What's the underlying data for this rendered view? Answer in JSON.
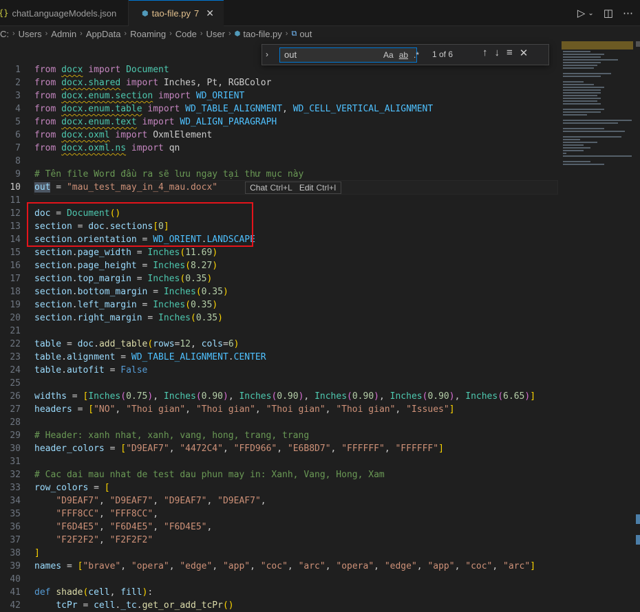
{
  "tabs": [
    {
      "icon": "{}",
      "label": "chatLanguageModels.json",
      "active": false
    },
    {
      "icon": "⬢",
      "label": "tao-file.py",
      "badge": "7",
      "active": true
    }
  ],
  "breadcrumb": [
    "C:",
    "Users",
    "Admin",
    "AppData",
    "Roaming",
    "Code",
    "User",
    "tao-file.py",
    "out"
  ],
  "find": {
    "query": "out",
    "opt_case": "Aa",
    "opt_word": "ab",
    "opt_regex": ".*",
    "count": "1 of 6"
  },
  "inline_hint": {
    "chat": "Chat",
    "chat_key": "Ctrl+L",
    "edit": "Edit",
    "edit_key": "Ctrl+I"
  },
  "line_numbers": [
    "1",
    "2",
    "3",
    "4",
    "5",
    "6",
    "7",
    "8",
    "9",
    "10",
    "11",
    "12",
    "13",
    "14",
    "15",
    "16",
    "17",
    "18",
    "19",
    "20",
    "21",
    "22",
    "23",
    "24",
    "25",
    "26",
    "27",
    "28",
    "29",
    "30",
    "31",
    "32",
    "33",
    "34",
    "35",
    "36",
    "37",
    "38",
    "39",
    "40",
    "41",
    "42"
  ],
  "current_line": 10,
  "code": [
    [
      [
        "k",
        "from "
      ],
      [
        "m",
        "docx"
      ],
      [
        "k",
        " import "
      ],
      [
        "m",
        "Document"
      ]
    ],
    [
      [
        "k",
        "from "
      ],
      [
        "m",
        "docx.shared"
      ],
      [
        "k",
        " import "
      ],
      [
        "p",
        "Inches, Pt, RGBColor"
      ]
    ],
    [
      [
        "k",
        "from "
      ],
      [
        "m",
        "docx.enum.section"
      ],
      [
        "k",
        " import "
      ],
      [
        "c",
        "WD_ORIENT"
      ]
    ],
    [
      [
        "k",
        "from "
      ],
      [
        "m",
        "docx.enum.table"
      ],
      [
        "k",
        " import "
      ],
      [
        "c",
        "WD_TABLE_ALIGNMENT"
      ],
      [
        "p",
        ", "
      ],
      [
        "c",
        "WD_CELL_VERTICAL_ALIGNMENT"
      ]
    ],
    [
      [
        "k",
        "from "
      ],
      [
        "m",
        "docx.enum.text"
      ],
      [
        "k",
        " import "
      ],
      [
        "c",
        "WD_ALIGN_PARAGRAPH"
      ]
    ],
    [
      [
        "k",
        "from "
      ],
      [
        "m",
        "docx.oxml"
      ],
      [
        "k",
        " import "
      ],
      [
        "p",
        "OxmlElement"
      ]
    ],
    [
      [
        "k",
        "from "
      ],
      [
        "m",
        "docx.oxml.ns"
      ],
      [
        "k",
        " import "
      ],
      [
        "p",
        "qn"
      ]
    ],
    [],
    [
      [
        "cm",
        "# Tên file Word đầu ra sẽ lưu ngay tại thư mục này"
      ]
    ],
    [
      [
        "vm",
        "out"
      ],
      [
        "p",
        " = "
      ],
      [
        "s",
        "\"mau_test_may_in_4_mau.docx\""
      ]
    ],
    [],
    [
      [
        "v",
        "doc"
      ],
      [
        "p",
        " = "
      ],
      [
        "m",
        "Document"
      ],
      [
        "br1",
        "()"
      ]
    ],
    [
      [
        "v",
        "section"
      ],
      [
        "p",
        " = "
      ],
      [
        "v",
        "doc"
      ],
      [
        "p",
        "."
      ],
      [
        "v",
        "sections"
      ],
      [
        "br1",
        "["
      ],
      [
        "n",
        "0"
      ],
      [
        "br1",
        "]"
      ]
    ],
    [
      [
        "v",
        "section"
      ],
      [
        "p",
        "."
      ],
      [
        "v",
        "orientation"
      ],
      [
        "p",
        " = "
      ],
      [
        "c",
        "WD_ORIENT"
      ],
      [
        "p",
        "."
      ],
      [
        "c",
        "LANDSCAPE"
      ]
    ],
    [
      [
        "v",
        "section"
      ],
      [
        "p",
        "."
      ],
      [
        "v",
        "page_width"
      ],
      [
        "p",
        " = "
      ],
      [
        "m",
        "Inches"
      ],
      [
        "br1",
        "("
      ],
      [
        "n",
        "11.69"
      ],
      [
        "br1",
        ")"
      ]
    ],
    [
      [
        "v",
        "section"
      ],
      [
        "p",
        "."
      ],
      [
        "v",
        "page_height"
      ],
      [
        "p",
        " = "
      ],
      [
        "m",
        "Inches"
      ],
      [
        "br1",
        "("
      ],
      [
        "n",
        "8.27"
      ],
      [
        "br1",
        ")"
      ]
    ],
    [
      [
        "v",
        "section"
      ],
      [
        "p",
        "."
      ],
      [
        "v",
        "top_margin"
      ],
      [
        "p",
        " = "
      ],
      [
        "m",
        "Inches"
      ],
      [
        "br1",
        "("
      ],
      [
        "n",
        "0.35"
      ],
      [
        "br1",
        ")"
      ]
    ],
    [
      [
        "v",
        "section"
      ],
      [
        "p",
        "."
      ],
      [
        "v",
        "bottom_margin"
      ],
      [
        "p",
        " = "
      ],
      [
        "m",
        "Inches"
      ],
      [
        "br1",
        "("
      ],
      [
        "n",
        "0.35"
      ],
      [
        "br1",
        ")"
      ]
    ],
    [
      [
        "v",
        "section"
      ],
      [
        "p",
        "."
      ],
      [
        "v",
        "left_margin"
      ],
      [
        "p",
        " = "
      ],
      [
        "m",
        "Inches"
      ],
      [
        "br1",
        "("
      ],
      [
        "n",
        "0.35"
      ],
      [
        "br1",
        ")"
      ]
    ],
    [
      [
        "v",
        "section"
      ],
      [
        "p",
        "."
      ],
      [
        "v",
        "right_margin"
      ],
      [
        "p",
        " = "
      ],
      [
        "m",
        "Inches"
      ],
      [
        "br1",
        "("
      ],
      [
        "n",
        "0.35"
      ],
      [
        "br1",
        ")"
      ]
    ],
    [],
    [
      [
        "v",
        "table"
      ],
      [
        "p",
        " = "
      ],
      [
        "v",
        "doc"
      ],
      [
        "p",
        "."
      ],
      [
        "f",
        "add_table"
      ],
      [
        "br1",
        "("
      ],
      [
        "v",
        "rows"
      ],
      [
        "p",
        "="
      ],
      [
        "n",
        "12"
      ],
      [
        "p",
        ", "
      ],
      [
        "v",
        "cols"
      ],
      [
        "p",
        "="
      ],
      [
        "n",
        "6"
      ],
      [
        "br1",
        ")"
      ]
    ],
    [
      [
        "v",
        "table"
      ],
      [
        "p",
        "."
      ],
      [
        "v",
        "alignment"
      ],
      [
        "p",
        " = "
      ],
      [
        "c",
        "WD_TABLE_ALIGNMENT"
      ],
      [
        "p",
        "."
      ],
      [
        "c",
        "CENTER"
      ]
    ],
    [
      [
        "v",
        "table"
      ],
      [
        "p",
        "."
      ],
      [
        "v",
        "autofit"
      ],
      [
        "p",
        " = "
      ],
      [
        "kw",
        "False"
      ]
    ],
    [],
    [
      [
        "v",
        "widths"
      ],
      [
        "p",
        " = "
      ],
      [
        "br1",
        "["
      ],
      [
        "m",
        "Inches"
      ],
      [
        "br2",
        "("
      ],
      [
        "n",
        "0.75"
      ],
      [
        "br2",
        ")"
      ],
      [
        "p",
        ", "
      ],
      [
        "m",
        "Inches"
      ],
      [
        "br2",
        "("
      ],
      [
        "n",
        "0.90"
      ],
      [
        "br2",
        ")"
      ],
      [
        "p",
        ", "
      ],
      [
        "m",
        "Inches"
      ],
      [
        "br2",
        "("
      ],
      [
        "n",
        "0.90"
      ],
      [
        "br2",
        ")"
      ],
      [
        "p",
        ", "
      ],
      [
        "m",
        "Inches"
      ],
      [
        "br2",
        "("
      ],
      [
        "n",
        "0.90"
      ],
      [
        "br2",
        ")"
      ],
      [
        "p",
        ", "
      ],
      [
        "m",
        "Inches"
      ],
      [
        "br2",
        "("
      ],
      [
        "n",
        "0.90"
      ],
      [
        "br2",
        ")"
      ],
      [
        "p",
        ", "
      ],
      [
        "m",
        "Inches"
      ],
      [
        "br2",
        "("
      ],
      [
        "n",
        "6.65"
      ],
      [
        "br2",
        ")"
      ],
      [
        "br1",
        "]"
      ]
    ],
    [
      [
        "v",
        "headers"
      ],
      [
        "p",
        " = "
      ],
      [
        "br1",
        "["
      ],
      [
        "s",
        "\"NO\""
      ],
      [
        "p",
        ", "
      ],
      [
        "s",
        "\"Thoi gian\""
      ],
      [
        "p",
        ", "
      ],
      [
        "s",
        "\"Thoi gian\""
      ],
      [
        "p",
        ", "
      ],
      [
        "s",
        "\"Thoi gian\""
      ],
      [
        "p",
        ", "
      ],
      [
        "s",
        "\"Thoi gian\""
      ],
      [
        "p",
        ", "
      ],
      [
        "s",
        "\"Issues\""
      ],
      [
        "br1",
        "]"
      ]
    ],
    [],
    [
      [
        "cm",
        "# Header: xanh nhat, xanh, vang, hong, trang, trang"
      ]
    ],
    [
      [
        "v",
        "header_colors"
      ],
      [
        "p",
        " = "
      ],
      [
        "br1",
        "["
      ],
      [
        "s",
        "\"D9EAF7\""
      ],
      [
        "p",
        ", "
      ],
      [
        "s",
        "\"4472C4\""
      ],
      [
        "p",
        ", "
      ],
      [
        "s",
        "\"FFD966\""
      ],
      [
        "p",
        ", "
      ],
      [
        "s",
        "\"E6B8D7\""
      ],
      [
        "p",
        ", "
      ],
      [
        "s",
        "\"FFFFFF\""
      ],
      [
        "p",
        ", "
      ],
      [
        "s",
        "\"FFFFFF\""
      ],
      [
        "br1",
        "]"
      ]
    ],
    [],
    [
      [
        "cm",
        "# Cac dai mau nhat de test dau phun may in: Xanh, Vang, Hong, Xam"
      ]
    ],
    [
      [
        "v",
        "row_colors"
      ],
      [
        "p",
        " = "
      ],
      [
        "br1",
        "["
      ]
    ],
    [
      [
        "p",
        "    "
      ],
      [
        "s",
        "\"D9EAF7\""
      ],
      [
        "p",
        ", "
      ],
      [
        "s",
        "\"D9EAF7\""
      ],
      [
        "p",
        ", "
      ],
      [
        "s",
        "\"D9EAF7\""
      ],
      [
        "p",
        ", "
      ],
      [
        "s",
        "\"D9EAF7\""
      ],
      [
        "p",
        ","
      ]
    ],
    [
      [
        "p",
        "    "
      ],
      [
        "s",
        "\"FFF8CC\""
      ],
      [
        "p",
        ", "
      ],
      [
        "s",
        "\"FFF8CC\""
      ],
      [
        "p",
        ","
      ]
    ],
    [
      [
        "p",
        "    "
      ],
      [
        "s",
        "\"F6D4E5\""
      ],
      [
        "p",
        ", "
      ],
      [
        "s",
        "\"F6D4E5\""
      ],
      [
        "p",
        ", "
      ],
      [
        "s",
        "\"F6D4E5\""
      ],
      [
        "p",
        ","
      ]
    ],
    [
      [
        "p",
        "    "
      ],
      [
        "s",
        "\"F2F2F2\""
      ],
      [
        "p",
        ", "
      ],
      [
        "s",
        "\"F2F2F2\""
      ]
    ],
    [
      [
        "br1",
        "]"
      ]
    ],
    [
      [
        "v",
        "names"
      ],
      [
        "p",
        " = "
      ],
      [
        "br1",
        "["
      ],
      [
        "s",
        "\"brave\""
      ],
      [
        "p",
        ", "
      ],
      [
        "s",
        "\"opera\""
      ],
      [
        "p",
        ", "
      ],
      [
        "s",
        "\"edge\""
      ],
      [
        "p",
        ", "
      ],
      [
        "s",
        "\"app\""
      ],
      [
        "p",
        ", "
      ],
      [
        "s",
        "\"coc\""
      ],
      [
        "p",
        ", "
      ],
      [
        "s",
        "\"arc\""
      ],
      [
        "p",
        ", "
      ],
      [
        "s",
        "\"opera\""
      ],
      [
        "p",
        ", "
      ],
      [
        "s",
        "\"edge\""
      ],
      [
        "p",
        ", "
      ],
      [
        "s",
        "\"app\""
      ],
      [
        "p",
        ", "
      ],
      [
        "s",
        "\"coc\""
      ],
      [
        "p",
        ", "
      ],
      [
        "s",
        "\"arc\""
      ],
      [
        "br1",
        "]"
      ]
    ],
    [],
    [
      [
        "kw",
        "def "
      ],
      [
        "f",
        "shade"
      ],
      [
        "br1",
        "("
      ],
      [
        "v",
        "cell"
      ],
      [
        "p",
        ", "
      ],
      [
        "v",
        "fill"
      ],
      [
        "br1",
        ")"
      ],
      [
        "p",
        ":"
      ]
    ],
    [
      [
        "p",
        "    "
      ],
      [
        "v",
        "tcPr"
      ],
      [
        "p",
        " = "
      ],
      [
        "v",
        "cell"
      ],
      [
        "p",
        "."
      ],
      [
        "v",
        "_tc"
      ],
      [
        "p",
        "."
      ],
      [
        "f",
        "get_or_add_tcPr"
      ],
      [
        "br1",
        "()"
      ]
    ]
  ],
  "squiggle_words": [
    "docx",
    "docx.shared",
    "docx.enum.section",
    "docx.enum.table",
    "docx.enum.text",
    "docx.oxml",
    "docx.oxml.ns"
  ],
  "colors": {
    "accent": "#0078d4",
    "highlight_box": "#e5141b",
    "background": "#1f1f1f"
  }
}
